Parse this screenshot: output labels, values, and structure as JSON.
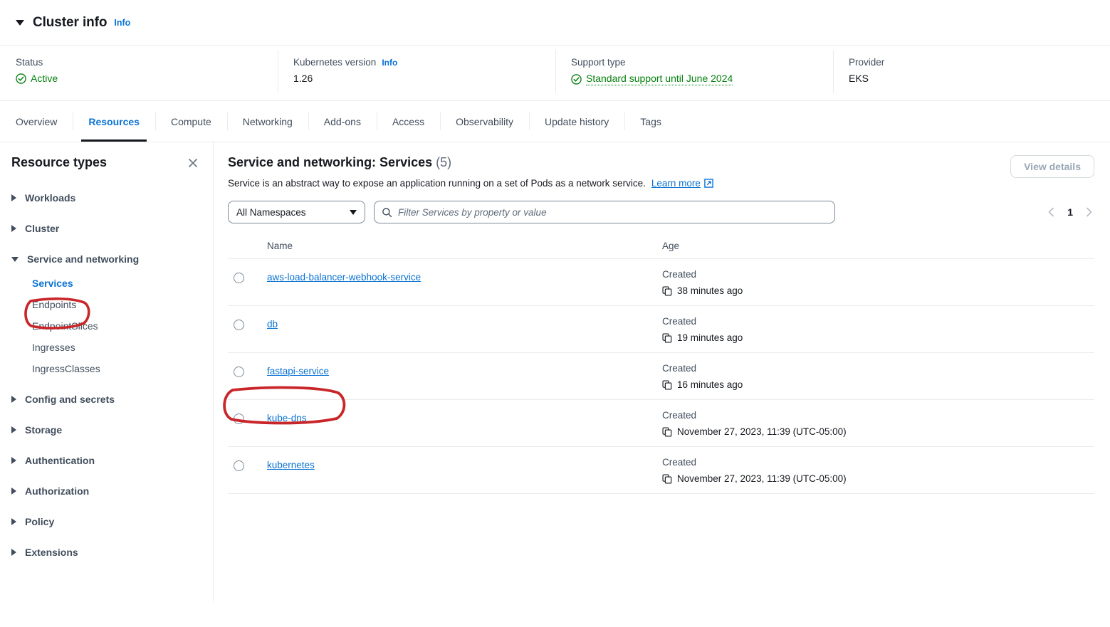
{
  "cluster_info": {
    "section_title": "Cluster info",
    "info_label": "Info",
    "fields": [
      {
        "label": "Status",
        "value": "Active",
        "icon": "check-circle-icon",
        "style": "green"
      },
      {
        "label": "Kubernetes version",
        "info_label": "Info",
        "value": "1.26",
        "style": "plain"
      },
      {
        "label": "Support type",
        "value": "Standard support until June 2024",
        "icon": "check-circle-icon",
        "style": "green-dotted"
      },
      {
        "label": "Provider",
        "value": "EKS",
        "style": "plain"
      }
    ]
  },
  "tabs": [
    {
      "label": "Overview",
      "active": false
    },
    {
      "label": "Resources",
      "active": true
    },
    {
      "label": "Compute",
      "active": false
    },
    {
      "label": "Networking",
      "active": false
    },
    {
      "label": "Add-ons",
      "active": false
    },
    {
      "label": "Access",
      "active": false
    },
    {
      "label": "Observability",
      "active": false
    },
    {
      "label": "Update history",
      "active": false
    },
    {
      "label": "Tags",
      "active": false
    }
  ],
  "sidebar": {
    "title": "Resource types",
    "close_icon": "close-icon",
    "groups": [
      {
        "label": "Workloads",
        "expanded": false,
        "children": []
      },
      {
        "label": "Cluster",
        "expanded": false,
        "children": []
      },
      {
        "label": "Service and networking",
        "expanded": true,
        "children": [
          {
            "label": "Services",
            "selected": true
          },
          {
            "label": "Endpoints",
            "selected": false
          },
          {
            "label": "EndpointSlices",
            "selected": false
          },
          {
            "label": "Ingresses",
            "selected": false
          },
          {
            "label": "IngressClasses",
            "selected": false
          }
        ]
      },
      {
        "label": "Config and secrets",
        "expanded": false,
        "children": []
      },
      {
        "label": "Storage",
        "expanded": false,
        "children": []
      },
      {
        "label": "Authentication",
        "expanded": false,
        "children": []
      },
      {
        "label": "Authorization",
        "expanded": false,
        "children": []
      },
      {
        "label": "Policy",
        "expanded": false,
        "children": []
      },
      {
        "label": "Extensions",
        "expanded": false,
        "children": []
      }
    ]
  },
  "main": {
    "title": "Service and networking: Services",
    "count": "(5)",
    "description": "Service is an abstract way to expose an application running on a set of Pods as a network service.",
    "learn_more": "Learn more",
    "view_details_button": "View details",
    "namespace_select": "All Namespaces",
    "search_placeholder": "Filter Services by property or value",
    "page_number": "1",
    "columns": {
      "name": "Name",
      "age": "Age"
    },
    "created_label": "Created",
    "rows": [
      {
        "name": "aws-load-balancer-webhook-service",
        "created": "Created",
        "age": "38 minutes ago",
        "selected": false
      },
      {
        "name": "db",
        "created": "Created",
        "age": "19 minutes ago",
        "selected": false
      },
      {
        "name": "fastapi-service",
        "created": "Created",
        "age": "16 minutes ago",
        "selected": false,
        "annotated": true
      },
      {
        "name": "kube-dns",
        "created": "Created",
        "age": "November 27, 2023, 11:39 (UTC-05:00)",
        "selected": false
      },
      {
        "name": "kubernetes",
        "created": "Created",
        "age": "November 27, 2023, 11:39 (UTC-05:00)",
        "selected": false
      }
    ]
  },
  "colors": {
    "link": "#0972d3",
    "success": "#037f0c",
    "text": "#16191f",
    "secondary_text": "#414d5c",
    "border": "#e9ebed",
    "annotation_red": "#c9262a"
  }
}
